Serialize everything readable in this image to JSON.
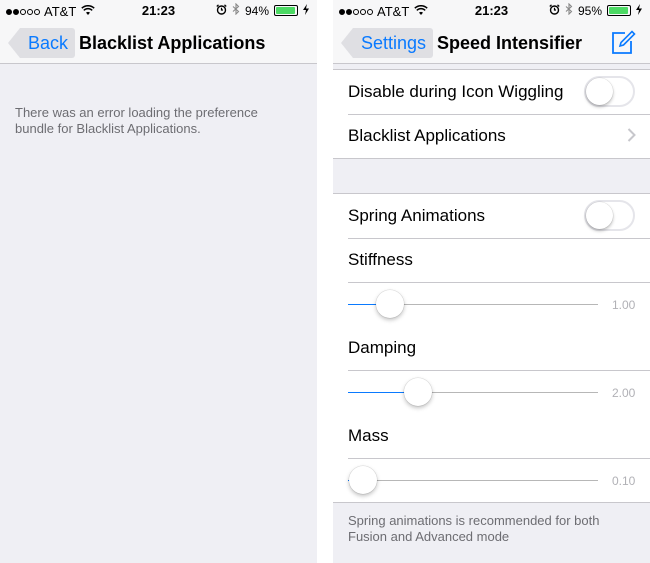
{
  "left": {
    "status_bar": {
      "carrier": "AT&T",
      "time": "21:23",
      "battery_percent": "94%",
      "battery_level": 0.94,
      "signal_bars_filled": 2,
      "signal_bars_total": 5
    },
    "nav": {
      "back_label": "Back",
      "title": "Blacklist Applications"
    },
    "error_message": "There was an error loading the preference bundle for Blacklist Applications."
  },
  "right": {
    "status_bar": {
      "carrier": "AT&T",
      "time": "21:23",
      "battery_percent": "95%",
      "battery_level": 0.95,
      "signal_bars_filled": 2,
      "signal_bars_total": 5
    },
    "nav": {
      "back_label": "Settings",
      "title": "Speed Intensifier",
      "action_icon": "compose-icon"
    },
    "group1": {
      "disable_wiggling": {
        "label": "Disable during Icon Wiggling",
        "on": false
      },
      "blacklist_apps": {
        "label": "Blacklist Applications"
      }
    },
    "group2": {
      "spring_animations": {
        "label": "Spring Animations",
        "on": false
      },
      "stiffness": {
        "label": "Stiffness",
        "value": "1.00",
        "level": 0.16
      },
      "damping": {
        "label": "Damping",
        "value": "2.00",
        "level": 0.27
      },
      "mass": {
        "label": "Mass",
        "value": "0.10",
        "level": 0.05
      }
    },
    "footer": "Spring animations is recommended for both Fusion and Advanced mode"
  },
  "colors": {
    "accent": "#0a7aff",
    "battery": "#4cd964",
    "background": "#efeff4",
    "separator": "#c8c7cc"
  }
}
